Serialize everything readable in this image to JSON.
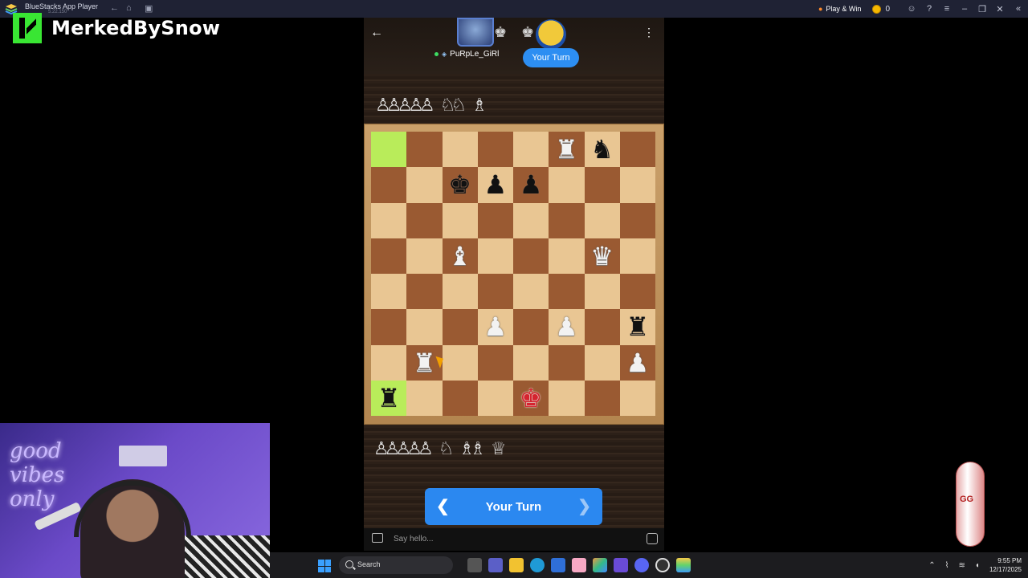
{
  "titlebar": {
    "app_title": "BlueStacks App Player",
    "subtitle": "5.22.150",
    "play_win": "Play & Win",
    "coin_count": "0"
  },
  "overlay": {
    "streamer_name": "MerkedBySnow",
    "neon_sign": "good vibes only",
    "side_badge": "GG"
  },
  "game": {
    "opponent_name": "PuRpLe_GiRl",
    "turn_pill": "Your Turn",
    "turn_button": "Your Turn",
    "chat_placeholder": "Say hello...",
    "captured_top": [
      "♙",
      "♙",
      "♙",
      "♙",
      "♙",
      "♘",
      "♘",
      "♗"
    ],
    "captured_bottom": [
      "♙",
      "♙",
      "♙",
      "♙",
      "♙",
      "♘",
      "♗",
      "♗",
      "♕"
    ],
    "board": [
      [
        "",
        "",
        "",
        "",
        "",
        "wR",
        "bN",
        ""
      ],
      [
        "",
        "",
        "bK",
        "bP",
        "bP",
        "",
        "",
        ""
      ],
      [
        "",
        "",
        "",
        "",
        "",
        "",
        "",
        ""
      ],
      [
        "",
        "",
        "wB",
        "",
        "",
        "",
        "wQ",
        ""
      ],
      [
        "",
        "",
        "",
        "",
        "",
        "",
        "",
        ""
      ],
      [
        "",
        "",
        "",
        "wP",
        "",
        "wP",
        "",
        "bR"
      ],
      [
        "",
        "wR",
        "",
        "",
        "",
        "",
        "",
        "wP"
      ],
      [
        "bR",
        "",
        "",
        "",
        "rK",
        "",
        "",
        ""
      ]
    ],
    "highlighted": [
      [
        0,
        0
      ],
      [
        7,
        0
      ]
    ]
  },
  "taskbar": {
    "search_label": "Search",
    "time": "9:55 PM",
    "date": "12/17/2025"
  },
  "colors": {
    "accent": "#2b88f0",
    "board_light": "#e9c693",
    "board_dark": "#9a5a32",
    "highlight": "#b9ec5a",
    "streamer_green": "#39e633"
  }
}
